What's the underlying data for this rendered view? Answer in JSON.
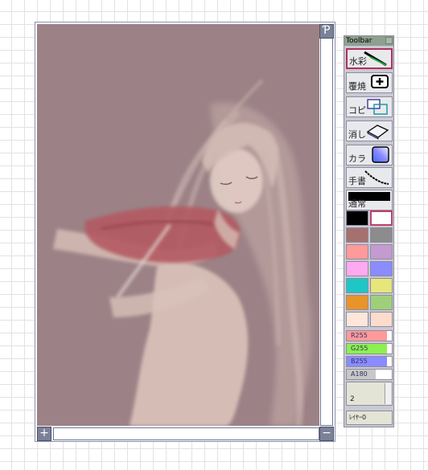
{
  "canvas_window": {
    "flip_button_label": "Ƥ",
    "zoom_in_label": "+",
    "zoom_out_label": "−"
  },
  "toolbar": {
    "title": "Toolbar",
    "tools": [
      {
        "label": "水彩",
        "icon": "brush-icon",
        "selected": true
      },
      {
        "label": "覆焼",
        "icon": "plus-icon"
      },
      {
        "label": "コピ",
        "icon": "copy-icon"
      },
      {
        "label": "消し",
        "icon": "eraser-icon"
      },
      {
        "label": "カラ",
        "icon": "color-gradient-icon"
      },
      {
        "label": "手書",
        "icon": "curve-icon"
      },
      {
        "label": "通常",
        "icon": "blend-mode-bar"
      }
    ],
    "swatches": [
      "#000000",
      "#ffffff",
      "#a67070",
      "#8c8c8c",
      "#ff9a9a",
      "#c49ad0",
      "#ffaaf0",
      "#8a8cff",
      "#1ec6c6",
      "#e6e67a",
      "#e89428",
      "#9ed07a",
      "#fde6da",
      "#fcdccc"
    ],
    "selected_swatch": 1,
    "sliders": [
      {
        "label": "R255",
        "value": 255,
        "color": "#ff9a9a"
      },
      {
        "label": "G255",
        "value": 255,
        "color": "#8cf050"
      },
      {
        "label": "B255",
        "value": 255,
        "color": "#8a8cff"
      },
      {
        "label": "A180",
        "value": 180,
        "color": "#c8c8c8"
      }
    ],
    "brush_size": "2",
    "layer_label": "ﾚｲﾔｰ0"
  }
}
